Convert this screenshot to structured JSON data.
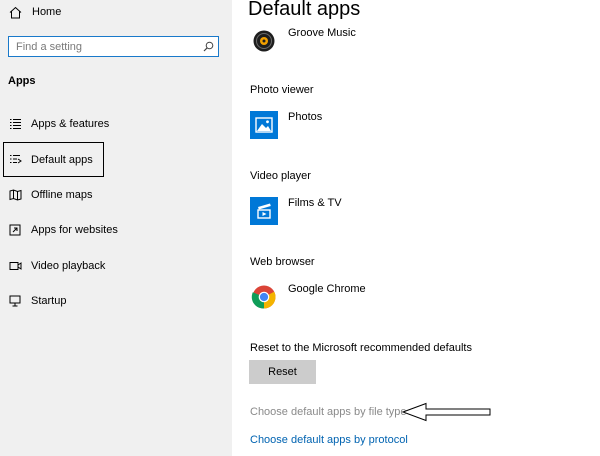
{
  "sidebar": {
    "home_label": "Home",
    "search_placeholder": "Find a setting",
    "section_title": "Apps",
    "items": [
      {
        "label": "Apps & features",
        "icon": "list-icon"
      },
      {
        "label": "Default apps",
        "icon": "default-apps-icon",
        "selected": true
      },
      {
        "label": "Offline maps",
        "icon": "map-icon"
      },
      {
        "label": "Apps for websites",
        "icon": "open-external-icon"
      },
      {
        "label": "Video playback",
        "icon": "video-icon"
      },
      {
        "label": "Startup",
        "icon": "startup-icon"
      }
    ]
  },
  "main": {
    "title": "Default apps",
    "music": {
      "app": "Groove Music"
    },
    "photo": {
      "label": "Photo viewer",
      "app": "Photos"
    },
    "video": {
      "label": "Video player",
      "app": "Films & TV"
    },
    "web": {
      "label": "Web browser",
      "app": "Google Chrome"
    },
    "reset_label": "Reset to the Microsoft recommended defaults",
    "reset_button": "Reset",
    "link_filetype": "Choose default apps by file type",
    "link_protocol": "Choose default apps by protocol"
  },
  "colors": {
    "accent": "#0063b1",
    "tile_blue": "#0078d7",
    "sidebar_bg": "#f0f0f0",
    "search_border": "#1979ca",
    "button_bg": "#cccccc"
  }
}
